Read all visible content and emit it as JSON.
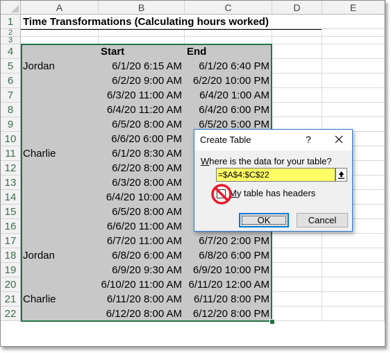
{
  "columns": [
    "A",
    "B",
    "C",
    "D",
    "E"
  ],
  "title": "Time Transformations (Calculating hours worked)",
  "rows": [
    {
      "num": "1"
    },
    {
      "num": "2"
    },
    {
      "num": "3"
    },
    {
      "num": "4",
      "a": "",
      "b": "Start",
      "c": "End"
    },
    {
      "num": "5",
      "a": "Jordan",
      "b": "6/1/20 6:15 AM",
      "c": "6/1/20 6:40 PM"
    },
    {
      "num": "6",
      "a": "",
      "b": "6/2/20 9:00 AM",
      "c": "6/2/20 10:00 PM"
    },
    {
      "num": "7",
      "a": "",
      "b": "6/3/20 11:00 AM",
      "c": "6/4/20 1:00 AM"
    },
    {
      "num": "8",
      "a": "",
      "b": "6/4/20 11:20 AM",
      "c": "6/4/20 6:00 PM"
    },
    {
      "num": "9",
      "a": "",
      "b": "6/5/20 8:00 AM",
      "c": "6/5/20 5:00 PM"
    },
    {
      "num": "10",
      "a": "",
      "b": "6/6/20 6:00 PM",
      "c": ""
    },
    {
      "num": "11",
      "a": "Charlie",
      "b": "6/1/20 8:30 AM",
      "c": ""
    },
    {
      "num": "12",
      "a": "",
      "b": "6/2/20 8:00 AM",
      "c": ""
    },
    {
      "num": "13",
      "a": "",
      "b": "6/3/20 8:00 AM",
      "c": ""
    },
    {
      "num": "14",
      "a": "",
      "b": "6/4/20 10:00 AM",
      "c": ""
    },
    {
      "num": "15",
      "a": "",
      "b": "6/5/20 8:00 AM",
      "c": ""
    },
    {
      "num": "16",
      "a": "",
      "b": "6/6/20 11:00 AM",
      "c": ""
    },
    {
      "num": "17",
      "a": "",
      "b": "6/7/20 11:00 AM",
      "c": "6/7/20 2:00 PM"
    },
    {
      "num": "18",
      "a": "Jordan",
      "b": "6/8/20 6:00 AM",
      "c": "6/8/20 6:00 PM"
    },
    {
      "num": "19",
      "a": "",
      "b": "6/9/20 9:30 AM",
      "c": "6/9/20 10:00 PM"
    },
    {
      "num": "20",
      "a": "",
      "b": "6/10/20 11:00 AM",
      "c": "6/11/20 12:00 AM"
    },
    {
      "num": "21",
      "a": "Charlie",
      "b": "6/11/20 8:00 AM",
      "c": "6/11/20 8:00 PM"
    },
    {
      "num": "22",
      "a": "",
      "b": "6/12/20 8:00 AM",
      "c": "6/12/20 8:00 PM"
    }
  ],
  "dialog": {
    "title": "Create Table",
    "help": "?",
    "prompt_underlined": "W",
    "prompt_rest": "here is the data for your table?",
    "range": "=$A$4:$C$22",
    "checkbox_checked": false,
    "checkbox_underlined": "M",
    "checkbox_rest": "y table has headers",
    "ok": "OK",
    "cancel": "Cancel"
  },
  "colors": {
    "table_fill": "#c8c8c8",
    "selection": "#217346",
    "range_highlight": "#ffff66",
    "no_sign": "#e8182c"
  }
}
